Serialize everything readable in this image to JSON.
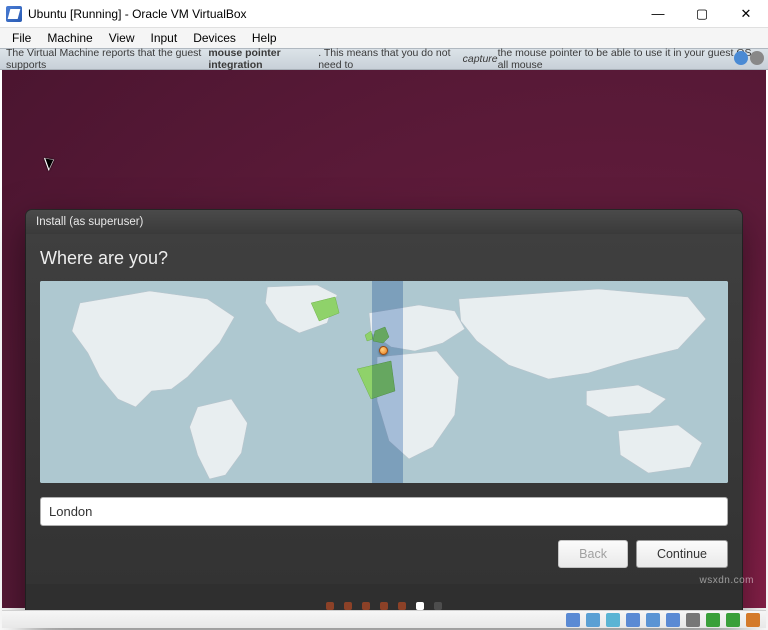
{
  "window": {
    "title": "Ubuntu [Running] - Oracle VM VirtualBox"
  },
  "menu": {
    "items": [
      "File",
      "Machine",
      "View",
      "Input",
      "Devices",
      "Help"
    ]
  },
  "info_bar": {
    "prefix": "The Virtual Machine reports that the guest supports ",
    "bold": "mouse pointer integration",
    "middle": ". This means that you do not need to ",
    "ital": "capture",
    "suffix": " the mouse pointer to be able to use it in your guest OS -- all mouse"
  },
  "installer": {
    "titlebar": "Install (as superuser)",
    "heading": "Where are you?",
    "location_value": "London",
    "back_label": "Back",
    "continue_label": "Continue",
    "dots_total": 7,
    "dots_active_index": 5
  },
  "colors": {
    "ocean": "#aec8d0",
    "land": "#e8eef0",
    "land_stroke": "#b8c4cc",
    "highlight": "#8fd26a",
    "tz_band": "#7fa5d2",
    "ubuntu_accent": "#e95420"
  },
  "status_icons": [
    "hdd-icon",
    "cd-icon",
    "net-icon",
    "usb-icon",
    "shared-icon",
    "display-icon",
    "rec-icon",
    "mouse-icon",
    "keyboard-icon",
    "rightctrl-icon"
  ],
  "watermark": "wsxdn.com"
}
